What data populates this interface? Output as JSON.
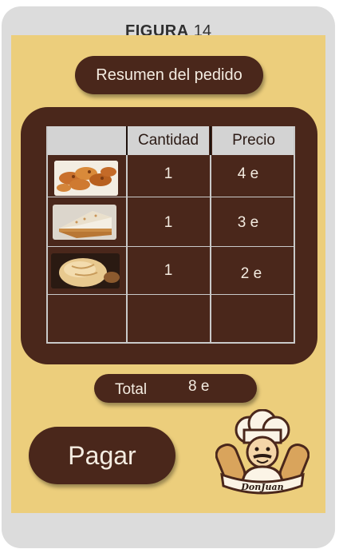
{
  "figure": {
    "label": "FIGURA",
    "number": "14"
  },
  "summary": {
    "title": "Resumen del pedido"
  },
  "table": {
    "headers": [
      "",
      "Cantidad",
      "Precio"
    ],
    "rows": [
      {
        "image": "pastry-image",
        "quantity": "1",
        "price": "4 e"
      },
      {
        "image": "cake-slice-image",
        "quantity": "1",
        "price": "3 e"
      },
      {
        "image": "bread-loaf-image",
        "quantity": "1",
        "price": "2 e"
      },
      {
        "image": "",
        "quantity": "",
        "price": ""
      }
    ]
  },
  "total": {
    "label": "Total",
    "value": "8 e"
  },
  "pay": {
    "label": "Pagar"
  },
  "logo": {
    "text": "DonJuan",
    "icon": "chef-logo-icon"
  },
  "colors": {
    "background": "#ecce7c",
    "brown": "#4a271b",
    "device": "#dcdcdc",
    "header_cell": "#d3d3d3"
  }
}
